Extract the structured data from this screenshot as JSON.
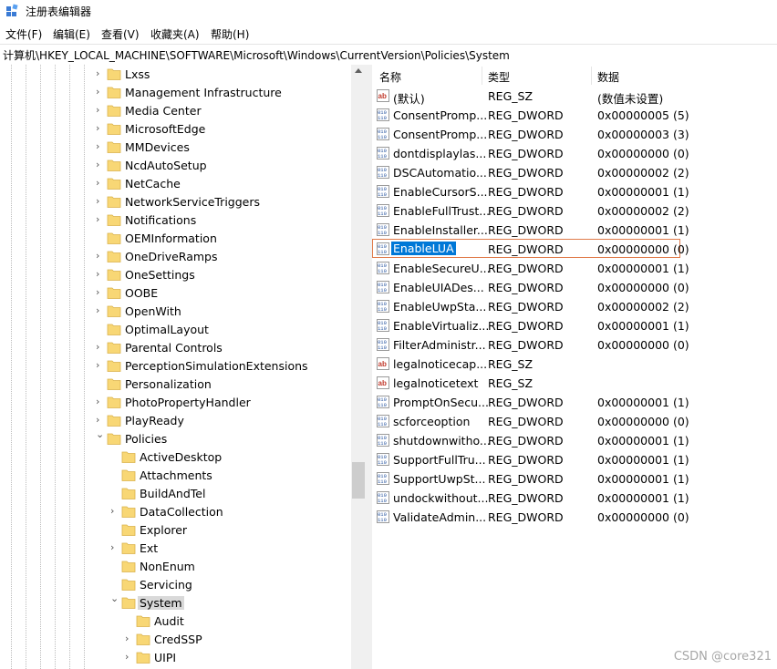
{
  "window": {
    "title": "注册表编辑器"
  },
  "menu": [
    "文件(F)",
    "编辑(E)",
    "查看(V)",
    "收藏夹(A)",
    "帮助(H)"
  ],
  "address": "计算机\\HKEY_LOCAL_MACHINE\\SOFTWARE\\Microsoft\\Windows\\CurrentVersion\\Policies\\System",
  "tree": [
    {
      "label": "Lxss",
      "level": 0,
      "chevron": "right"
    },
    {
      "label": "Management Infrastructure",
      "level": 0,
      "chevron": "right"
    },
    {
      "label": "Media Center",
      "level": 0,
      "chevron": "right"
    },
    {
      "label": "MicrosoftEdge",
      "level": 0,
      "chevron": "right"
    },
    {
      "label": "MMDevices",
      "level": 0,
      "chevron": "right"
    },
    {
      "label": "NcdAutoSetup",
      "level": 0,
      "chevron": "right"
    },
    {
      "label": "NetCache",
      "level": 0,
      "chevron": "right"
    },
    {
      "label": "NetworkServiceTriggers",
      "level": 0,
      "chevron": "right"
    },
    {
      "label": "Notifications",
      "level": 0,
      "chevron": "right"
    },
    {
      "label": "OEMInformation",
      "level": 0,
      "chevron": "none"
    },
    {
      "label": "OneDriveRamps",
      "level": 0,
      "chevron": "right"
    },
    {
      "label": "OneSettings",
      "level": 0,
      "chevron": "right"
    },
    {
      "label": "OOBE",
      "level": 0,
      "chevron": "right"
    },
    {
      "label": "OpenWith",
      "level": 0,
      "chevron": "right"
    },
    {
      "label": "OptimalLayout",
      "level": 0,
      "chevron": "none"
    },
    {
      "label": "Parental Controls",
      "level": 0,
      "chevron": "right"
    },
    {
      "label": "PerceptionSimulationExtensions",
      "level": 0,
      "chevron": "right"
    },
    {
      "label": "Personalization",
      "level": 0,
      "chevron": "none"
    },
    {
      "label": "PhotoPropertyHandler",
      "level": 0,
      "chevron": "right"
    },
    {
      "label": "PlayReady",
      "level": 0,
      "chevron": "right"
    },
    {
      "label": "Policies",
      "level": 0,
      "chevron": "down"
    },
    {
      "label": "ActiveDesktop",
      "level": 1,
      "chevron": "none"
    },
    {
      "label": "Attachments",
      "level": 1,
      "chevron": "none"
    },
    {
      "label": "BuildAndTel",
      "level": 1,
      "chevron": "none"
    },
    {
      "label": "DataCollection",
      "level": 1,
      "chevron": "right"
    },
    {
      "label": "Explorer",
      "level": 1,
      "chevron": "none"
    },
    {
      "label": "Ext",
      "level": 1,
      "chevron": "right"
    },
    {
      "label": "NonEnum",
      "level": 1,
      "chevron": "none"
    },
    {
      "label": "Servicing",
      "level": 1,
      "chevron": "none"
    },
    {
      "label": "System",
      "level": 1,
      "chevron": "down",
      "selected": true
    },
    {
      "label": "Audit",
      "level": 2,
      "chevron": "none"
    },
    {
      "label": "CredSSP",
      "level": 2,
      "chevron": "right"
    },
    {
      "label": "UIPI",
      "level": 2,
      "chevron": "right"
    }
  ],
  "columns": {
    "name": "名称",
    "type": "类型",
    "data": "数据"
  },
  "values": [
    {
      "name": "(默认)",
      "type": "REG_SZ",
      "data": "(数值未设置)",
      "icon": "string-value-icon"
    },
    {
      "name": "ConsentPromp...",
      "type": "REG_DWORD",
      "data": "0x00000005 (5)",
      "icon": "dword-value-icon"
    },
    {
      "name": "ConsentPromp...",
      "type": "REG_DWORD",
      "data": "0x00000003 (3)",
      "icon": "dword-value-icon"
    },
    {
      "name": "dontdisplaylas...",
      "type": "REG_DWORD",
      "data": "0x00000000 (0)",
      "icon": "dword-value-icon"
    },
    {
      "name": "DSCAutomatio...",
      "type": "REG_DWORD",
      "data": "0x00000002 (2)",
      "icon": "dword-value-icon"
    },
    {
      "name": "EnableCursorS...",
      "type": "REG_DWORD",
      "data": "0x00000001 (1)",
      "icon": "dword-value-icon"
    },
    {
      "name": "EnableFullTrust...",
      "type": "REG_DWORD",
      "data": "0x00000002 (2)",
      "icon": "dword-value-icon"
    },
    {
      "name": "EnableInstaller...",
      "type": "REG_DWORD",
      "data": "0x00000001 (1)",
      "icon": "dword-value-icon"
    },
    {
      "name": "EnableLUA",
      "type": "REG_DWORD",
      "data": "0x00000000 (0)",
      "icon": "dword-value-icon",
      "selected": true
    },
    {
      "name": "EnableSecureU...",
      "type": "REG_DWORD",
      "data": "0x00000001 (1)",
      "icon": "dword-value-icon"
    },
    {
      "name": "EnableUIADes...",
      "type": "REG_DWORD",
      "data": "0x00000000 (0)",
      "icon": "dword-value-icon"
    },
    {
      "name": "EnableUwpSta...",
      "type": "REG_DWORD",
      "data": "0x00000002 (2)",
      "icon": "dword-value-icon"
    },
    {
      "name": "EnableVirtualiz...",
      "type": "REG_DWORD",
      "data": "0x00000001 (1)",
      "icon": "dword-value-icon"
    },
    {
      "name": "FilterAdministr...",
      "type": "REG_DWORD",
      "data": "0x00000000 (0)",
      "icon": "dword-value-icon"
    },
    {
      "name": "legalnoticecap...",
      "type": "REG_SZ",
      "data": "",
      "icon": "string-value-icon"
    },
    {
      "name": "legalnoticetext",
      "type": "REG_SZ",
      "data": "",
      "icon": "string-value-icon"
    },
    {
      "name": "PromptOnSecu...",
      "type": "REG_DWORD",
      "data": "0x00000001 (1)",
      "icon": "dword-value-icon"
    },
    {
      "name": "scforceoption",
      "type": "REG_DWORD",
      "data": "0x00000000 (0)",
      "icon": "dword-value-icon"
    },
    {
      "name": "shutdownwitho...",
      "type": "REG_DWORD",
      "data": "0x00000001 (1)",
      "icon": "dword-value-icon"
    },
    {
      "name": "SupportFullTru...",
      "type": "REG_DWORD",
      "data": "0x00000001 (1)",
      "icon": "dword-value-icon"
    },
    {
      "name": "SupportUwpSt...",
      "type": "REG_DWORD",
      "data": "0x00000001 (1)",
      "icon": "dword-value-icon"
    },
    {
      "name": "undockwithout...",
      "type": "REG_DWORD",
      "data": "0x00000001 (1)",
      "icon": "dword-value-icon"
    },
    {
      "name": "ValidateAdmin...",
      "type": "REG_DWORD",
      "data": "0x00000000 (0)",
      "icon": "dword-value-icon"
    }
  ],
  "watermark": "CSDN @core321",
  "colors": {
    "selection": "#0078d7",
    "folder": "#f8d775",
    "tree_selected": "#d9d9d9",
    "focus_border": "#e07b4a"
  }
}
